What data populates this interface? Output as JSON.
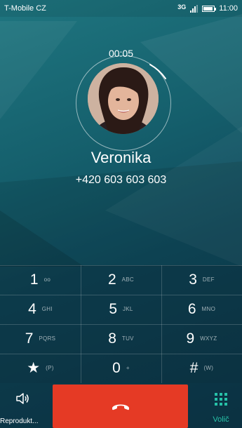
{
  "status_bar": {
    "carrier": "T-Mobile CZ",
    "network": "3G",
    "time": "11:00",
    "battery_level": 0.9,
    "signal_bars": 3
  },
  "call": {
    "timer": "00:05",
    "contact_name": "Veronika",
    "phone_number": "+420 603 603 603"
  },
  "keypad": [
    {
      "digit": "1",
      "letters": "oo"
    },
    {
      "digit": "2",
      "letters": "ABC"
    },
    {
      "digit": "3",
      "letters": "DEF"
    },
    {
      "digit": "4",
      "letters": "GHI"
    },
    {
      "digit": "5",
      "letters": "JKL"
    },
    {
      "digit": "6",
      "letters": "MNO"
    },
    {
      "digit": "7",
      "letters": "PQRS"
    },
    {
      "digit": "8",
      "letters": "TUV"
    },
    {
      "digit": "9",
      "letters": "WXYZ"
    },
    {
      "digit": "★",
      "letters": "(P)"
    },
    {
      "digit": "0",
      "letters": "+"
    },
    {
      "digit": "#",
      "letters": "(W)"
    }
  ],
  "actions": {
    "speaker_label": "Reprodukt...",
    "dialer_label": "Volič"
  },
  "colors": {
    "end_call": "#e53a25",
    "accent": "#27c1a8",
    "background": "#155f6c"
  },
  "icons": {
    "speaker": "speaker-icon",
    "end_call": "phone-hangup-icon",
    "dialer": "dialpad-icon"
  }
}
